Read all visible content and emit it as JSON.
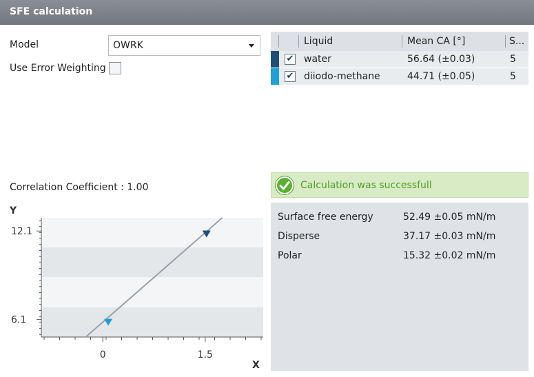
{
  "window": {
    "title": "SFE calculation"
  },
  "form": {
    "model_label": "Model",
    "model_value": "OWRK",
    "error_weighting_label": "Use Error Weighting",
    "error_weighting_checked": false
  },
  "table": {
    "headers": {
      "liquid": "Liquid",
      "mean_ca": "Mean CA [°]",
      "s": "S..."
    },
    "rows": [
      {
        "color": "#1f4e79",
        "checked": true,
        "liquid": "water",
        "mean_ca": "56.64 (±0.03)",
        "s": "5"
      },
      {
        "color": "#1fa0d6",
        "checked": true,
        "liquid": "diiodo-methane",
        "mean_ca": "44.71 (±0.05)",
        "s": "5"
      }
    ]
  },
  "correlation": {
    "label": "Correlation Coefficient : 1.00"
  },
  "status": {
    "message": "Calculation was successfull",
    "icon": "check-circle-icon",
    "color": "#5bb030"
  },
  "results": [
    {
      "label": "Surface free energy",
      "value": "52.49 ±0.05 mN/m"
    },
    {
      "label": "Disperse",
      "value": "37.17 ±0.03 mN/m"
    },
    {
      "label": "Polar",
      "value": "15.32 ±0.02 mN/m"
    }
  ],
  "chart_data": {
    "type": "scatter",
    "xlabel": "X",
    "ylabel": "Y",
    "xticks": [
      0,
      1.5
    ],
    "yticks": [
      6.1,
      12.1
    ],
    "xlim": [
      -0.9,
      2.35
    ],
    "ylim": [
      4.9,
      13.0
    ],
    "points": [
      {
        "x": 1.52,
        "y": 11.9,
        "color": "#1f4e79",
        "marker": "triangle-down"
      },
      {
        "x": 0.08,
        "y": 5.9,
        "color": "#1fa0d6",
        "marker": "triangle-down"
      }
    ],
    "fit_line": {
      "x": [
        -0.25,
        1.75
      ],
      "y": [
        4.9,
        13.0
      ],
      "color": "#9aa0a6"
    },
    "grid": "horizontal bands"
  }
}
